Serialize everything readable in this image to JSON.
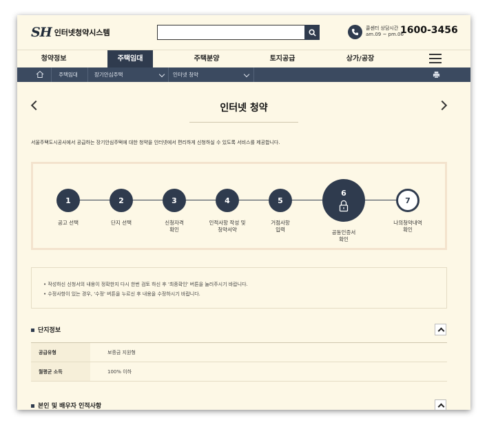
{
  "header": {
    "logo_mark": "SH",
    "logo_text": "인터넷청약시스템",
    "search_placeholder": "",
    "call_center_label": "콜센터 상담시간",
    "call_center_hours": "am.09 ~ pm.06",
    "call_center_number": "1600-3456"
  },
  "gnb": {
    "items": [
      {
        "label": "청약정보"
      },
      {
        "label": "주택임대"
      },
      {
        "label": "주택분양"
      },
      {
        "label": "토지공급"
      },
      {
        "label": "상가/공장"
      }
    ],
    "active_index": 1
  },
  "breadcrumb": {
    "items": [
      {
        "label": "주택임대"
      },
      {
        "label": "장기안심주택"
      },
      {
        "label": "인터넷 청약"
      }
    ]
  },
  "page": {
    "title": "인터넷 청약",
    "intro": "서울주택도시공사에서 공급하는 장기안심주택에 대한 청약을 인터넷에서 편리하게 신청하실 수 있도록 서비스를 제공합니다."
  },
  "steps": [
    {
      "number": "1",
      "label_1": "공고 선택",
      "label_2": ""
    },
    {
      "number": "2",
      "label_1": "단지 선택",
      "label_2": ""
    },
    {
      "number": "3",
      "label_1": "신청자격",
      "label_2": "확인"
    },
    {
      "number": "4",
      "label_1": "인적사항 작성 및",
      "label_2": "청약서약"
    },
    {
      "number": "5",
      "label_1": "거점사항",
      "label_2": "입력"
    },
    {
      "number": "6",
      "label_1": "공동인증서",
      "label_2": "확인"
    },
    {
      "number": "7",
      "label_1": "나의청약내역",
      "label_2": "확인"
    }
  ],
  "current_step": 6,
  "notice": [
    "• 작성하신 신청서의 내용이 정확한지 다시 한번 검토 하신 후 '최종확인' 버튼을 눌러주시기 바랍니다.",
    "• 수정사항이 있는 경우, '수정' 버튼을 누르신 후 내용을 수정하시기 바랍니다."
  ],
  "complex_section": {
    "title": "단지정보",
    "rows": [
      {
        "label": "공급유형",
        "value": "보증금 지원형"
      },
      {
        "label": "월평균 소득",
        "value": "100% 이하"
      }
    ]
  },
  "personal_section": {
    "title": "본인 및 배우자 인적사항"
  },
  "colors": {
    "navy": "#2f3b4e",
    "background": "#fdf8e6",
    "steps_border": "#f3e3cd"
  }
}
